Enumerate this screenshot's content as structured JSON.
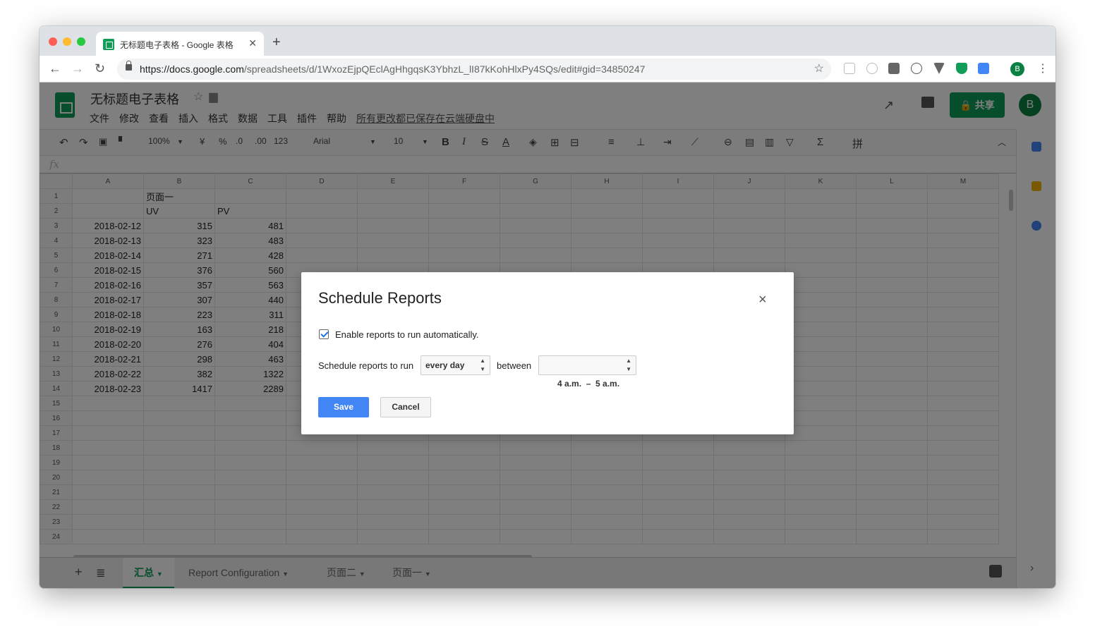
{
  "browser": {
    "tab_title": "无标题电子表格 - Google 表格",
    "url_host": "https://docs.google.com",
    "url_path": "/spreadsheets/d/1WxozEjpQEclAgHhgqsK3YbhzL_lI87kKohHlxPy4SQs/edit#gid=34850247",
    "new_tab": "+",
    "avatar": "B"
  },
  "sheets": {
    "doc_title": "无标题电子表格",
    "menu": [
      "文件",
      "修改",
      "查看",
      "插入",
      "格式",
      "数据",
      "工具",
      "插件",
      "帮助"
    ],
    "saved_status": "所有更改都已保存在云端硬盘中",
    "share_label": "共享",
    "avatar": "B",
    "toolbar": {
      "zoom": "100%",
      "currency": "¥",
      "percent": "%",
      "dec_minus": ".0",
      "dec_plus": ".00",
      "more_formats": "123",
      "font": "Arial",
      "font_size": "10"
    },
    "fx": "fx"
  },
  "grid": {
    "columns": [
      "A",
      "B",
      "C",
      "D",
      "E",
      "F",
      "G",
      "H",
      "I",
      "J",
      "K",
      "L",
      "M"
    ],
    "rows": [
      [
        "",
        "页面一",
        "",
        "",
        "",
        "",
        "",
        "",
        "",
        "",
        "",
        "",
        ""
      ],
      [
        "",
        "UV",
        "PV",
        "",
        "",
        "",
        "",
        "",
        "",
        "",
        "",
        "",
        ""
      ],
      [
        "2018-02-12",
        "315",
        "481",
        "",
        "",
        "",
        "",
        "",
        "",
        "",
        "",
        "",
        ""
      ],
      [
        "2018-02-13",
        "323",
        "483",
        "",
        "",
        "",
        "",
        "",
        "",
        "",
        "",
        "",
        ""
      ],
      [
        "2018-02-14",
        "271",
        "428",
        "",
        "",
        "",
        "",
        "",
        "",
        "",
        "",
        "",
        ""
      ],
      [
        "2018-02-15",
        "376",
        "560",
        "",
        "",
        "",
        "",
        "",
        "",
        "",
        "",
        "",
        ""
      ],
      [
        "2018-02-16",
        "357",
        "563",
        "",
        "",
        "",
        "",
        "",
        "",
        "",
        "",
        "",
        ""
      ],
      [
        "2018-02-17",
        "307",
        "440",
        "",
        "",
        "",
        "",
        "",
        "",
        "",
        "",
        "",
        ""
      ],
      [
        "2018-02-18",
        "223",
        "311",
        "",
        "",
        "",
        "",
        "",
        "",
        "",
        "",
        "",
        ""
      ],
      [
        "2018-02-19",
        "163",
        "218",
        "",
        "",
        "",
        "",
        "",
        "",
        "",
        "",
        "",
        ""
      ],
      [
        "2018-02-20",
        "276",
        "404",
        "",
        "",
        "",
        "",
        "",
        "",
        "",
        "",
        "",
        ""
      ],
      [
        "2018-02-21",
        "298",
        "463",
        "",
        "",
        "",
        "",
        "",
        "",
        "",
        "",
        "",
        ""
      ],
      [
        "2018-02-22",
        "382",
        "1322",
        "",
        "",
        "",
        "",
        "",
        "",
        "",
        "",
        "",
        ""
      ],
      [
        "2018-02-23",
        "1417",
        "2289",
        "",
        "",
        "",
        "",
        "",
        "",
        "",
        "",
        "",
        ""
      ],
      [
        "",
        "",
        "",
        "",
        "",
        "",
        "",
        "",
        "",
        "",
        "",
        "",
        ""
      ],
      [
        "",
        "",
        "",
        "",
        "",
        "",
        "",
        "",
        "",
        "",
        "",
        "",
        ""
      ],
      [
        "",
        "",
        "",
        "",
        "",
        "",
        "",
        "",
        "",
        "",
        "",
        "",
        ""
      ],
      [
        "",
        "",
        "",
        "",
        "",
        "",
        "",
        "",
        "",
        "",
        "",
        "",
        ""
      ],
      [
        "",
        "",
        "",
        "",
        "",
        "",
        "",
        "",
        "",
        "",
        "",
        "",
        ""
      ],
      [
        "",
        "",
        "",
        "",
        "",
        "",
        "",
        "",
        "",
        "",
        "",
        "",
        ""
      ],
      [
        "",
        "",
        "",
        "",
        "",
        "",
        "",
        "",
        "",
        "",
        "",
        "",
        ""
      ],
      [
        "",
        "",
        "",
        "",
        "",
        "",
        "",
        "",
        "",
        "",
        "",
        "",
        ""
      ],
      [
        "",
        "",
        "",
        "",
        "",
        "",
        "",
        "",
        "",
        "",
        "",
        "",
        ""
      ],
      [
        "",
        "",
        "",
        "",
        "",
        "",
        "",
        "",
        "",
        "",
        "",
        "",
        ""
      ]
    ]
  },
  "sheet_tabs": [
    "汇总",
    "Report Configuration",
    "页面二",
    "页面一"
  ],
  "dialog": {
    "title": "Schedule Reports",
    "close": "×",
    "checkbox_label": "Enable reports to run automatically.",
    "checkbox_checked": true,
    "schedule_label": "Schedule reports to run",
    "frequency": "every day",
    "between_label": "between",
    "time_range": "4 a.m.  –  5 a.m.",
    "save_label": "Save",
    "cancel_label": "Cancel"
  },
  "colors": {
    "accent": "#0f9d58",
    "save_button": "#4285f4"
  }
}
